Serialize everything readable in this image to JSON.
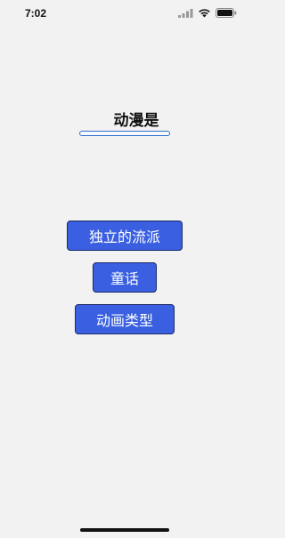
{
  "status_bar": {
    "time": "7:02",
    "icons": [
      "cellular-signal-icon",
      "wifi-icon",
      "battery-icon"
    ]
  },
  "question": {
    "title": "动漫是",
    "answer_value": ""
  },
  "options": [
    {
      "label": "独立的流派"
    },
    {
      "label": "童话"
    },
    {
      "label": "动画类型"
    }
  ],
  "colors": {
    "background": "#f2f2f3",
    "button": "#3a5fe0",
    "button_border": "#1b2a66",
    "field_border": "#2f6fce"
  }
}
